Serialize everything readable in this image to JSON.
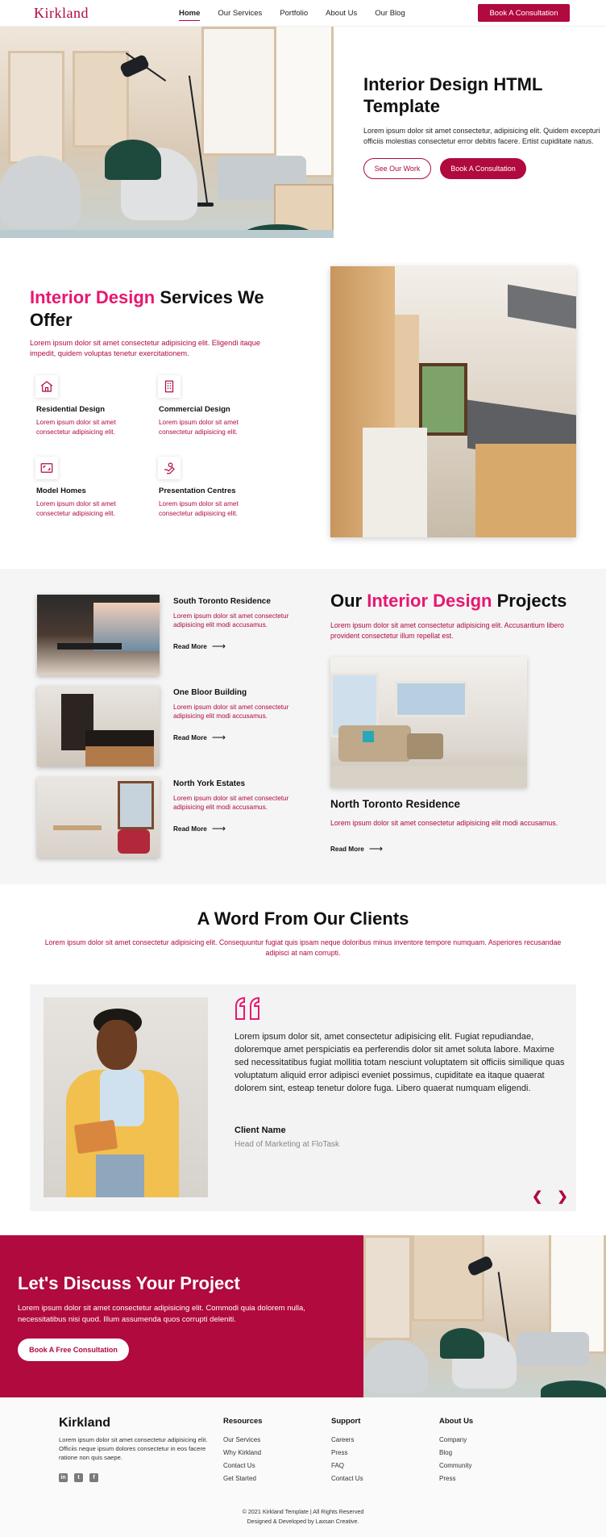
{
  "header": {
    "logo": "Kirkland",
    "nav": [
      "Home",
      "Our Services",
      "Portfolio",
      "About Us",
      "Our Blog"
    ],
    "cta": "Book A Consultation"
  },
  "hero": {
    "title": "Interior Design HTML Template",
    "text": "Lorem ipsum dolor sit amet consectetur, adipisicing elit. Quidem excepturi officiis molestias consectetur error debitis facere. Ertist cupiditate natus.",
    "btn_primary": "See Our Work",
    "btn_secondary": "Book A Consultation"
  },
  "services": {
    "title_highlight": "Interior Design",
    "title_rest": " Services We Offer",
    "desc": "Lorem ipsum dolor sit amet consectetur adipisicing elit. Eligendi itaque impedit, quidem voluptas tenetur exercitationem.",
    "items": [
      {
        "title": "Residential Design",
        "text": "Lorem ipsum dolor sit amet consectetur adipisicing elit."
      },
      {
        "title": "Commercial Design",
        "text": "Lorem ipsum dolor sit amet consectetur adipisicing elit."
      },
      {
        "title": "Model Homes",
        "text": "Lorem ipsum dolor sit amet consectetur adipisicing elit."
      },
      {
        "title": "Presentation Centres",
        "text": "Lorem ipsum dolor sit amet consectetur adipisicing elit."
      }
    ]
  },
  "projects": {
    "title_pre": "Our ",
    "title_highlight": "Interior Design",
    "title_post": " Projects",
    "desc": "Lorem ipsum dolor sit amet consectetur adipisicing elit. Accusantium libero provident consectetur illum repellat est.",
    "list": [
      {
        "title": "South Toronto Residence",
        "text": "Lorem ipsum dolor sit amet consectetur adipisicing elit modi accusamus.",
        "link": "Read More"
      },
      {
        "title": "One Bloor Building",
        "text": "Lorem ipsum dolor sit amet consectetur adipisicing elit modi accusamus.",
        "link": "Read More"
      },
      {
        "title": "North York Estates",
        "text": "Lorem ipsum dolor sit amet consectetur adipisicing elit modi accusamus.",
        "link": "Read More"
      }
    ],
    "featured": {
      "title": "North Toronto Residence",
      "text": "Lorem ipsum dolor sit amet consectetur adipisicing elit modi accusamus.",
      "link": "Read More"
    }
  },
  "testimonials": {
    "title": "A Word From Our Clients",
    "lead": "Lorem ipsum dolor sit amet consectetur adipisicing elit. Consequuntur fugiat quis ipsam neque doloribus minus inventore tempore numquam. Asperiores recusandae adipisci at nam corrupti.",
    "quote": "Lorem ipsum dolor sit, amet consectetur adipisicing elit. Fugiat repudiandae, doloremque amet perspiciatis ea perferendis dolor sit amet soluta labore. Maxime sed necessitatibus fugiat mollitia totam nesciunt voluptatem sit officiis similique quas voluptatum aliquid error adipisci eveniet possimus, cupiditate ea itaque quaerat dolorem sint, esteap tenetur dolore fuga. Libero quaerat numquam eligendi.",
    "name": "Client Name",
    "role": "Head of Marketing at FloTask",
    "prev": "❮",
    "next": "❯"
  },
  "cta": {
    "title": "Let's Discuss Your Project",
    "text": "Lorem ipsum dolor sit amet consectetur adipisicing elit. Commodi quia dolorem nulla, necessitatibus nisi quod. Illum assumenda quos corrupti deleniti.",
    "button": "Book A Free Consultation"
  },
  "footer": {
    "brand": "Kirkland",
    "desc": "Lorem ipsum dolor sit amet consectetur adipisicing elit. Officiis neque ipsum dolores consectetur in eos facere ratione non quis saepe.",
    "social": [
      "in",
      "t",
      "f"
    ],
    "columns": [
      {
        "title": "Resources",
        "links": [
          "Our Services",
          "Why Kirkland",
          "Contact Us",
          "Get Started"
        ]
      },
      {
        "title": "Support",
        "links": [
          "Careers",
          "Press",
          "FAQ",
          "Contact Us"
        ]
      },
      {
        "title": "About Us",
        "links": [
          "Company",
          "Blog",
          "Community",
          "Press"
        ]
      }
    ],
    "copyright": "© 2021 Kirkland Template | All Rights Reserved",
    "credit": "Designed & Developed by Laxsan Creative."
  },
  "colors": {
    "primary": "#b00a3e",
    "accent": "#e8176f"
  }
}
